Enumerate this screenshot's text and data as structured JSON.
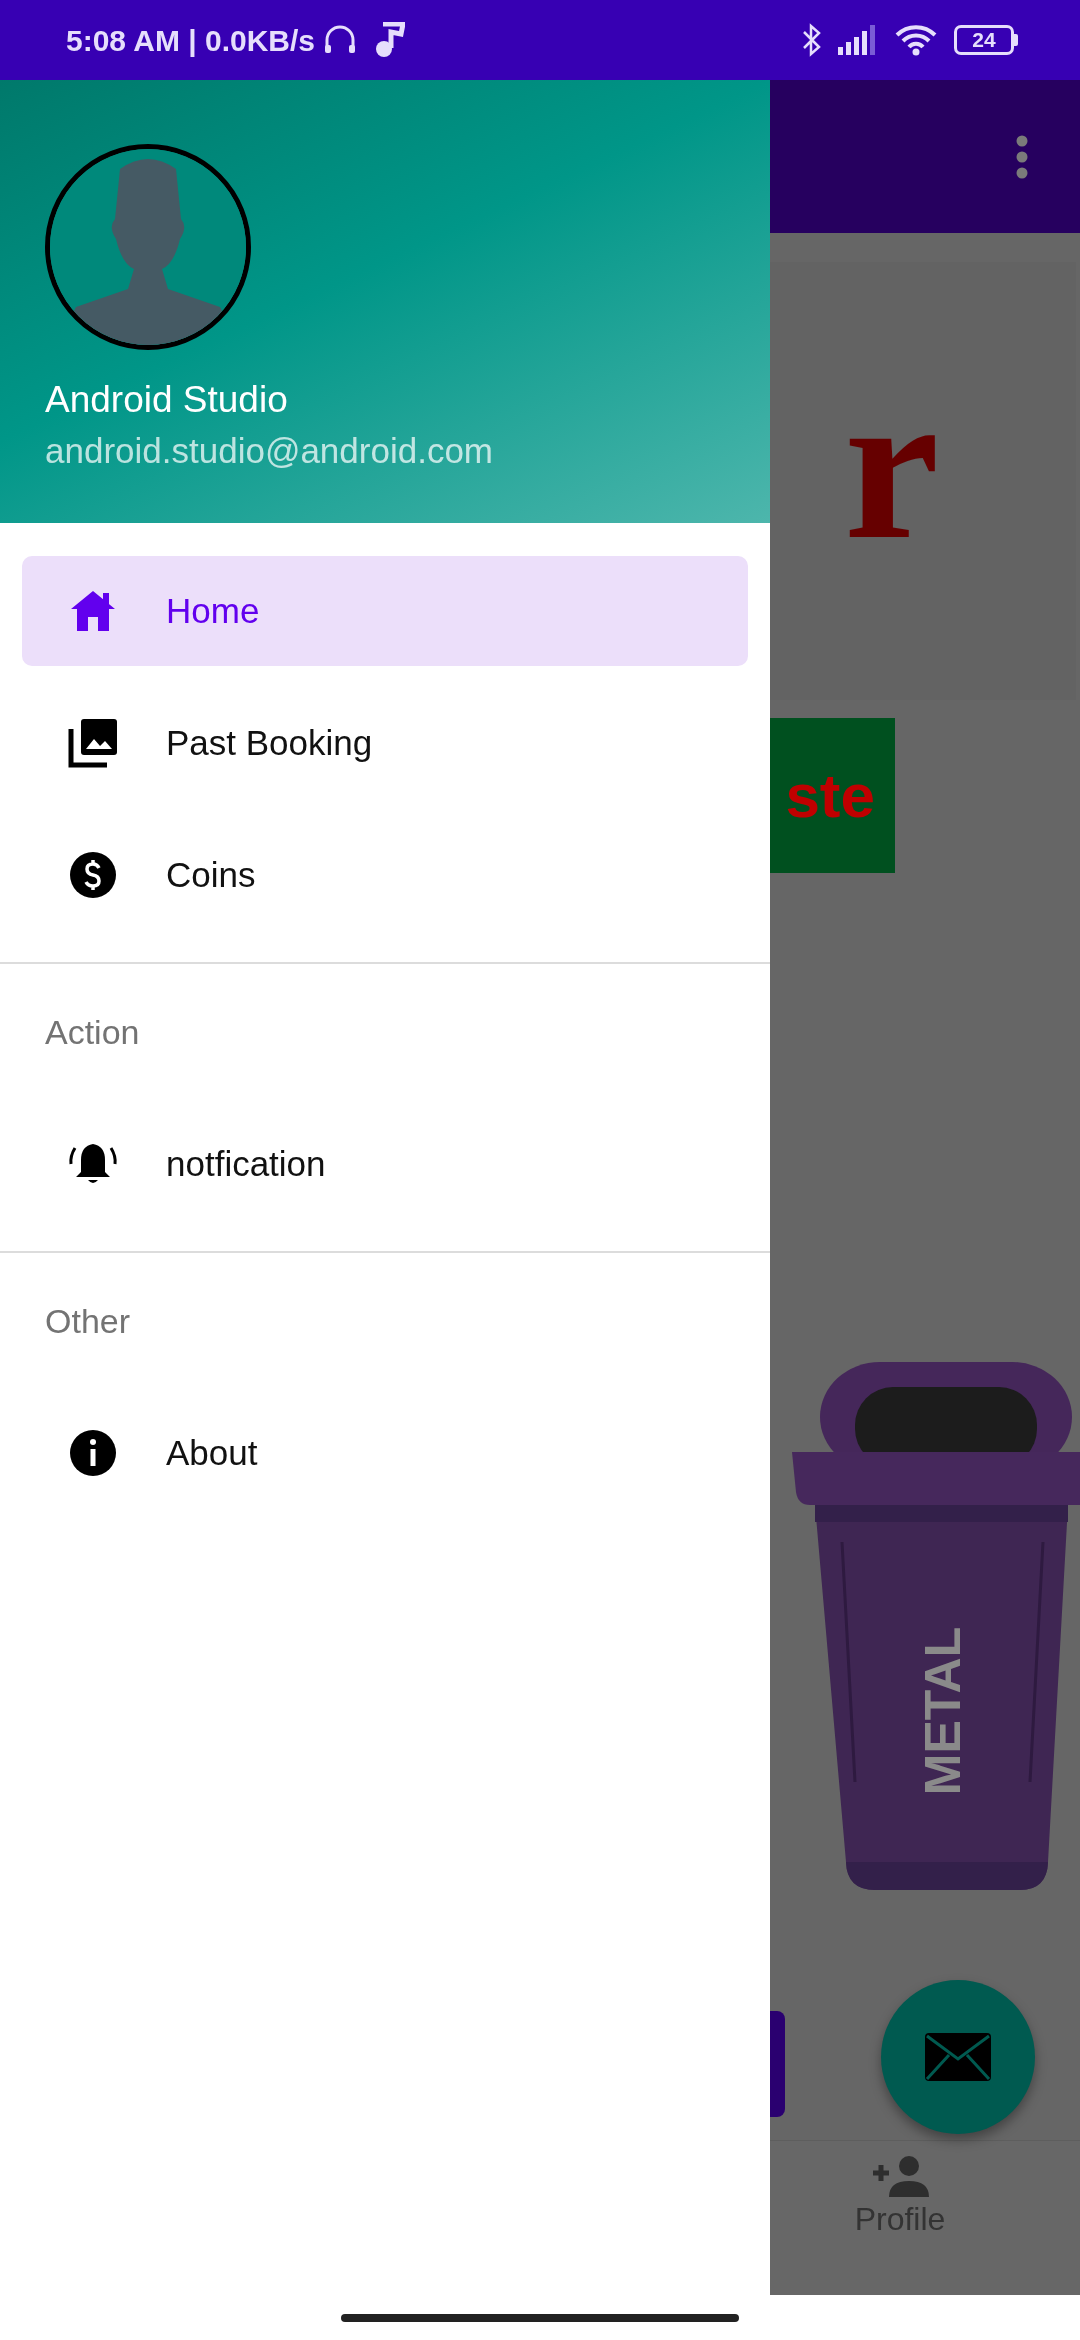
{
  "status_bar": {
    "time": "5:08 AM | 0.0KB/s",
    "battery": "24"
  },
  "background": {
    "logo_text": "r",
    "banner_text": "ste",
    "bin_label": "METAL",
    "nav_items": [
      {
        "label": "Profile",
        "kind": "profile"
      }
    ]
  },
  "drawer": {
    "header": {
      "name": "Android Studio",
      "email": "android.studio@android.com"
    },
    "sections": [
      {
        "items": [
          {
            "label": "Home",
            "kind": "home",
            "selected": true
          },
          {
            "label": "Past Booking",
            "kind": "gallery",
            "selected": false
          },
          {
            "label": "Coins",
            "kind": "coins",
            "selected": false
          }
        ]
      },
      {
        "title": "Action",
        "items": [
          {
            "label": "notfication",
            "kind": "notification",
            "selected": false
          }
        ]
      },
      {
        "title": "Other",
        "items": [
          {
            "label": "About",
            "kind": "about",
            "selected": false
          }
        ]
      }
    ]
  }
}
